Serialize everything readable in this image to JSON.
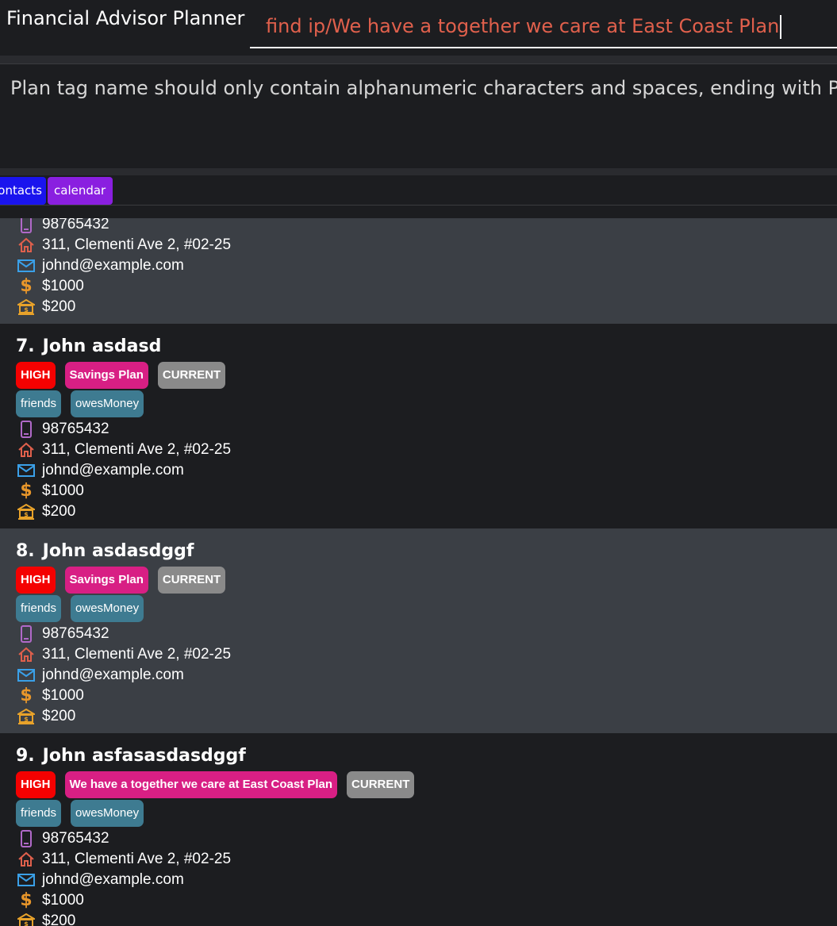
{
  "app": {
    "title": "Financial Advisor Planner"
  },
  "command": {
    "value": "find ip/We have a together we care at East Coast Plan"
  },
  "result": {
    "message": "Plan tag name should only contain alphanumeric characters and spaces, ending with Plan"
  },
  "tabs": [
    {
      "label": "ontacts"
    },
    {
      "label": "calendar"
    }
  ],
  "colors": {
    "accent_text": "#e0604c",
    "high": "#f40101",
    "plan": "#d81f84",
    "current": "#8a8a8a",
    "soft_tag": "#3e7b91",
    "tab_contacts": "#1a14ee",
    "tab_calendar": "#8a1fe0"
  },
  "cards": [
    {
      "phone": "98765432",
      "address": "311, Clementi Ave 2, #02-25",
      "email": "johnd@example.com",
      "income": "$1000",
      "monthly": "$200"
    },
    {
      "index": "7.",
      "name": "John asdasd",
      "priority": "HIGH",
      "plan": "Savings Plan",
      "status": "CURRENT",
      "tags": [
        "friends",
        "owesMoney"
      ],
      "phone": "98765432",
      "address": "311, Clementi Ave 2, #02-25",
      "email": "johnd@example.com",
      "income": "$1000",
      "monthly": "$200"
    },
    {
      "index": "8.",
      "name": "John asdasdggf",
      "priority": "HIGH",
      "plan": "Savings Plan",
      "status": "CURRENT",
      "tags": [
        "friends",
        "owesMoney"
      ],
      "phone": "98765432",
      "address": "311, Clementi Ave 2, #02-25",
      "email": "johnd@example.com",
      "income": "$1000",
      "monthly": "$200"
    },
    {
      "index": "9.",
      "name": "John asfasasdasdggf",
      "priority": "HIGH",
      "plan": "We have a together we care at East Coast Plan",
      "status": "CURRENT",
      "tags": [
        "friends",
        "owesMoney"
      ],
      "phone": "98765432",
      "address": "311, Clementi Ave 2, #02-25",
      "email": "johnd@example.com",
      "income": "$1000",
      "monthly": "$200"
    }
  ],
  "icons": {
    "phone": "phone-icon",
    "address": "home-icon",
    "email": "email-icon",
    "income": "dollar-icon",
    "monthly": "bank-icon"
  }
}
